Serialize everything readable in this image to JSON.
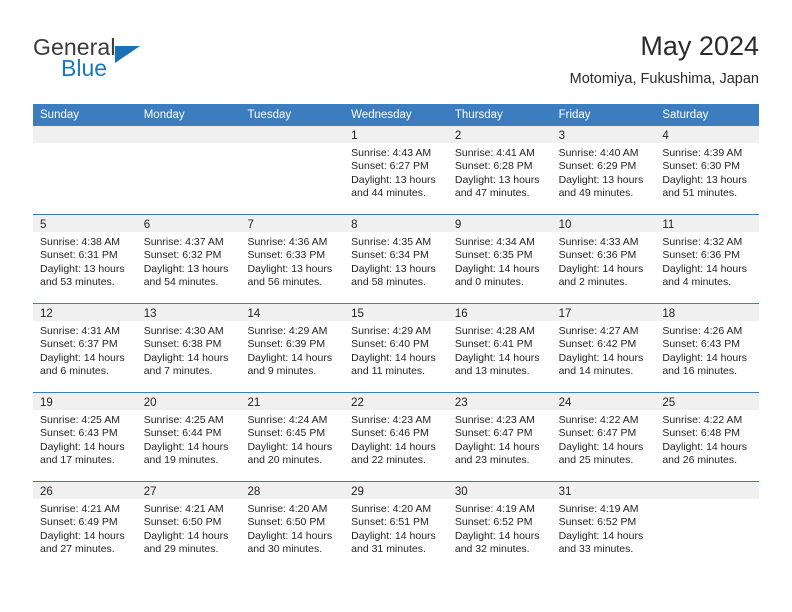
{
  "brand": {
    "name_part1": "General",
    "name_part2": "Blue",
    "accent_color": "#1b6fb5"
  },
  "header": {
    "title": "May 2024",
    "subtitle": "Motomiya, Fukushima, Japan"
  },
  "theme": {
    "header_row_bg": "#3b7dbf",
    "day_number_bg": "#f0f0f0",
    "text_color": "#231f20"
  },
  "weekdays": [
    "Sunday",
    "Monday",
    "Tuesday",
    "Wednesday",
    "Thursday",
    "Friday",
    "Saturday"
  ],
  "weeks": [
    [
      {
        "day": "",
        "sunrise": "",
        "sunset": "",
        "daylight1": "",
        "daylight2": ""
      },
      {
        "day": "",
        "sunrise": "",
        "sunset": "",
        "daylight1": "",
        "daylight2": ""
      },
      {
        "day": "",
        "sunrise": "",
        "sunset": "",
        "daylight1": "",
        "daylight2": ""
      },
      {
        "day": "1",
        "sunrise": "Sunrise: 4:43 AM",
        "sunset": "Sunset: 6:27 PM",
        "daylight1": "Daylight: 13 hours",
        "daylight2": "and 44 minutes."
      },
      {
        "day": "2",
        "sunrise": "Sunrise: 4:41 AM",
        "sunset": "Sunset: 6:28 PM",
        "daylight1": "Daylight: 13 hours",
        "daylight2": "and 47 minutes."
      },
      {
        "day": "3",
        "sunrise": "Sunrise: 4:40 AM",
        "sunset": "Sunset: 6:29 PM",
        "daylight1": "Daylight: 13 hours",
        "daylight2": "and 49 minutes."
      },
      {
        "day": "4",
        "sunrise": "Sunrise: 4:39 AM",
        "sunset": "Sunset: 6:30 PM",
        "daylight1": "Daylight: 13 hours",
        "daylight2": "and 51 minutes."
      }
    ],
    [
      {
        "day": "5",
        "sunrise": "Sunrise: 4:38 AM",
        "sunset": "Sunset: 6:31 PM",
        "daylight1": "Daylight: 13 hours",
        "daylight2": "and 53 minutes."
      },
      {
        "day": "6",
        "sunrise": "Sunrise: 4:37 AM",
        "sunset": "Sunset: 6:32 PM",
        "daylight1": "Daylight: 13 hours",
        "daylight2": "and 54 minutes."
      },
      {
        "day": "7",
        "sunrise": "Sunrise: 4:36 AM",
        "sunset": "Sunset: 6:33 PM",
        "daylight1": "Daylight: 13 hours",
        "daylight2": "and 56 minutes."
      },
      {
        "day": "8",
        "sunrise": "Sunrise: 4:35 AM",
        "sunset": "Sunset: 6:34 PM",
        "daylight1": "Daylight: 13 hours",
        "daylight2": "and 58 minutes."
      },
      {
        "day": "9",
        "sunrise": "Sunrise: 4:34 AM",
        "sunset": "Sunset: 6:35 PM",
        "daylight1": "Daylight: 14 hours",
        "daylight2": "and 0 minutes."
      },
      {
        "day": "10",
        "sunrise": "Sunrise: 4:33 AM",
        "sunset": "Sunset: 6:36 PM",
        "daylight1": "Daylight: 14 hours",
        "daylight2": "and 2 minutes."
      },
      {
        "day": "11",
        "sunrise": "Sunrise: 4:32 AM",
        "sunset": "Sunset: 6:36 PM",
        "daylight1": "Daylight: 14 hours",
        "daylight2": "and 4 minutes."
      }
    ],
    [
      {
        "day": "12",
        "sunrise": "Sunrise: 4:31 AM",
        "sunset": "Sunset: 6:37 PM",
        "daylight1": "Daylight: 14 hours",
        "daylight2": "and 6 minutes."
      },
      {
        "day": "13",
        "sunrise": "Sunrise: 4:30 AM",
        "sunset": "Sunset: 6:38 PM",
        "daylight1": "Daylight: 14 hours",
        "daylight2": "and 7 minutes."
      },
      {
        "day": "14",
        "sunrise": "Sunrise: 4:29 AM",
        "sunset": "Sunset: 6:39 PM",
        "daylight1": "Daylight: 14 hours",
        "daylight2": "and 9 minutes."
      },
      {
        "day": "15",
        "sunrise": "Sunrise: 4:29 AM",
        "sunset": "Sunset: 6:40 PM",
        "daylight1": "Daylight: 14 hours",
        "daylight2": "and 11 minutes."
      },
      {
        "day": "16",
        "sunrise": "Sunrise: 4:28 AM",
        "sunset": "Sunset: 6:41 PM",
        "daylight1": "Daylight: 14 hours",
        "daylight2": "and 13 minutes."
      },
      {
        "day": "17",
        "sunrise": "Sunrise: 4:27 AM",
        "sunset": "Sunset: 6:42 PM",
        "daylight1": "Daylight: 14 hours",
        "daylight2": "and 14 minutes."
      },
      {
        "day": "18",
        "sunrise": "Sunrise: 4:26 AM",
        "sunset": "Sunset: 6:43 PM",
        "daylight1": "Daylight: 14 hours",
        "daylight2": "and 16 minutes."
      }
    ],
    [
      {
        "day": "19",
        "sunrise": "Sunrise: 4:25 AM",
        "sunset": "Sunset: 6:43 PM",
        "daylight1": "Daylight: 14 hours",
        "daylight2": "and 17 minutes."
      },
      {
        "day": "20",
        "sunrise": "Sunrise: 4:25 AM",
        "sunset": "Sunset: 6:44 PM",
        "daylight1": "Daylight: 14 hours",
        "daylight2": "and 19 minutes."
      },
      {
        "day": "21",
        "sunrise": "Sunrise: 4:24 AM",
        "sunset": "Sunset: 6:45 PM",
        "daylight1": "Daylight: 14 hours",
        "daylight2": "and 20 minutes."
      },
      {
        "day": "22",
        "sunrise": "Sunrise: 4:23 AM",
        "sunset": "Sunset: 6:46 PM",
        "daylight1": "Daylight: 14 hours",
        "daylight2": "and 22 minutes."
      },
      {
        "day": "23",
        "sunrise": "Sunrise: 4:23 AM",
        "sunset": "Sunset: 6:47 PM",
        "daylight1": "Daylight: 14 hours",
        "daylight2": "and 23 minutes."
      },
      {
        "day": "24",
        "sunrise": "Sunrise: 4:22 AM",
        "sunset": "Sunset: 6:47 PM",
        "daylight1": "Daylight: 14 hours",
        "daylight2": "and 25 minutes."
      },
      {
        "day": "25",
        "sunrise": "Sunrise: 4:22 AM",
        "sunset": "Sunset: 6:48 PM",
        "daylight1": "Daylight: 14 hours",
        "daylight2": "and 26 minutes."
      }
    ],
    [
      {
        "day": "26",
        "sunrise": "Sunrise: 4:21 AM",
        "sunset": "Sunset: 6:49 PM",
        "daylight1": "Daylight: 14 hours",
        "daylight2": "and 27 minutes."
      },
      {
        "day": "27",
        "sunrise": "Sunrise: 4:21 AM",
        "sunset": "Sunset: 6:50 PM",
        "daylight1": "Daylight: 14 hours",
        "daylight2": "and 29 minutes."
      },
      {
        "day": "28",
        "sunrise": "Sunrise: 4:20 AM",
        "sunset": "Sunset: 6:50 PM",
        "daylight1": "Daylight: 14 hours",
        "daylight2": "and 30 minutes."
      },
      {
        "day": "29",
        "sunrise": "Sunrise: 4:20 AM",
        "sunset": "Sunset: 6:51 PM",
        "daylight1": "Daylight: 14 hours",
        "daylight2": "and 31 minutes."
      },
      {
        "day": "30",
        "sunrise": "Sunrise: 4:19 AM",
        "sunset": "Sunset: 6:52 PM",
        "daylight1": "Daylight: 14 hours",
        "daylight2": "and 32 minutes."
      },
      {
        "day": "31",
        "sunrise": "Sunrise: 4:19 AM",
        "sunset": "Sunset: 6:52 PM",
        "daylight1": "Daylight: 14 hours",
        "daylight2": "and 33 minutes."
      },
      {
        "day": "",
        "sunrise": "",
        "sunset": "",
        "daylight1": "",
        "daylight2": ""
      }
    ]
  ]
}
